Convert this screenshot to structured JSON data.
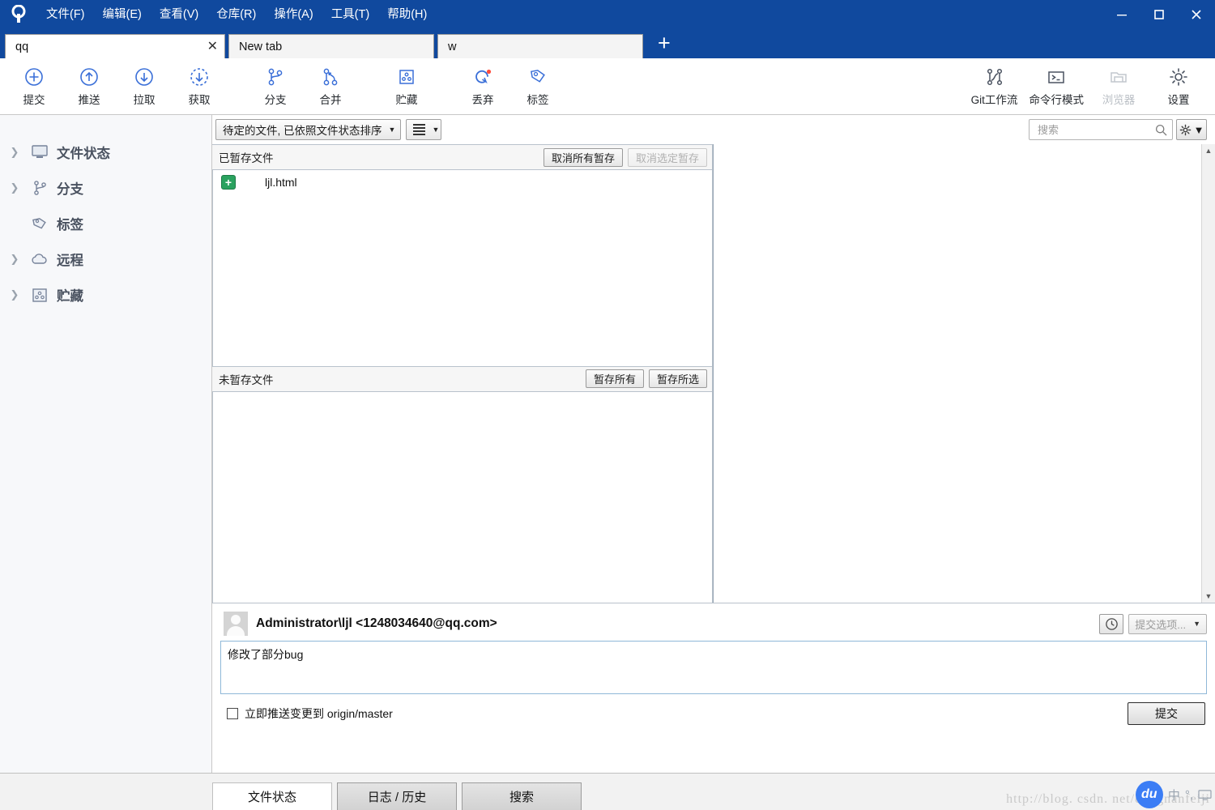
{
  "window": {
    "logo_icon": "sourcetree-logo-icon",
    "minimize_label": "–",
    "maximize_label": "□",
    "close_label": "✕"
  },
  "menubar": {
    "items": [
      {
        "label": "文件(F)",
        "name": "menu-file"
      },
      {
        "label": "编辑(E)",
        "name": "menu-edit"
      },
      {
        "label": "查看(V)",
        "name": "menu-view"
      },
      {
        "label": "仓库(R)",
        "name": "menu-repository"
      },
      {
        "label": "操作(A)",
        "name": "menu-actions"
      },
      {
        "label": "工具(T)",
        "name": "menu-tools"
      },
      {
        "label": "帮助(H)",
        "name": "menu-help"
      }
    ]
  },
  "tabs": {
    "items": [
      {
        "label": "qq",
        "active": true,
        "close_label": "✕"
      },
      {
        "label": "New tab",
        "active": false
      },
      {
        "label": "w",
        "active": false
      }
    ],
    "new_tab_label": "+"
  },
  "toolbar": {
    "left": [
      {
        "label": "提交",
        "icon": "commit-icon"
      },
      {
        "label": "推送",
        "icon": "push-icon"
      },
      {
        "label": "拉取",
        "icon": "pull-icon"
      },
      {
        "label": "获取",
        "icon": "fetch-icon"
      },
      {
        "label": "分支",
        "icon": "branch-icon"
      },
      {
        "label": "合并",
        "icon": "merge-icon"
      },
      {
        "label": "贮藏",
        "icon": "stash-icon"
      },
      {
        "label": "丢弃",
        "icon": "discard-icon"
      },
      {
        "label": "标签",
        "icon": "tag-icon"
      }
    ],
    "right": [
      {
        "label": "Git工作流",
        "icon": "gitflow-icon",
        "disabled": false
      },
      {
        "label": "命令行模式",
        "icon": "terminal-icon",
        "disabled": false
      },
      {
        "label": "浏览器",
        "icon": "explorer-icon",
        "disabled": true
      },
      {
        "label": "设置",
        "icon": "settings-gear-icon",
        "disabled": false
      }
    ]
  },
  "sidebar": {
    "items": [
      {
        "label": "文件状态",
        "icon": "monitor-icon",
        "expandable": true
      },
      {
        "label": "分支",
        "icon": "branch-icon",
        "expandable": true
      },
      {
        "label": "标签",
        "icon": "tag-icon",
        "expandable": false
      },
      {
        "label": "远程",
        "icon": "cloud-icon",
        "expandable": true
      },
      {
        "label": "贮藏",
        "icon": "stash-icon",
        "expandable": true
      }
    ]
  },
  "filterbar": {
    "sort_value": "待定的文件, 已依照文件状态排序",
    "view_mode_icon": "list-lines-icon",
    "caret": "▼"
  },
  "search": {
    "placeholder": "搜索",
    "icon": "search-icon",
    "gear_icon": "gear-icon",
    "caret": "▼"
  },
  "staged": {
    "title": "已暂存文件",
    "unstage_all_label": "取消所有暂存",
    "unstage_selected_label": "取消选定暂存",
    "unstage_selected_disabled": true,
    "files": [
      {
        "name": "ljl.html",
        "status": "added",
        "status_glyph": "+",
        "status_color": "#2aa25f"
      }
    ]
  },
  "unstaged": {
    "title": "未暂存文件",
    "stage_all_label": "暂存所有",
    "stage_selected_label": "暂存所选",
    "files": []
  },
  "commit": {
    "author": "Administrator\\ljl <1248034640@qq.com>",
    "avatar_icon": "user-avatar-icon",
    "history_icon": "clock-icon",
    "options_label": "提交选项...",
    "options_caret": "▼",
    "options_disabled": true,
    "message": "修改了部分bug",
    "message_placeholder": "",
    "push_checkbox_label": "立即推送变更到 origin/master",
    "push_checkbox_checked": false,
    "commit_button_label": "提交"
  },
  "bottom_tabs": {
    "items": [
      {
        "label": "文件状态",
        "active": true
      },
      {
        "label": "日志 / 历史",
        "active": false
      },
      {
        "label": "搜索",
        "active": false
      }
    ]
  },
  "watermark": {
    "text": "http://blog. csdn. net/dongnanfeiji",
    "ime_badge": "du",
    "ime_mode": "中",
    "ime_punct": "°,",
    "ime_panel_icon": "ime-keyboard-icon"
  },
  "scrollbar": {
    "up_arrow": "▲",
    "down_arrow": "▼"
  },
  "colors": {
    "titlebar": "#10499e",
    "accent_icon": "#3a6fd8",
    "added_green": "#2aa25f",
    "discard_dot": "#ff4d3d"
  }
}
